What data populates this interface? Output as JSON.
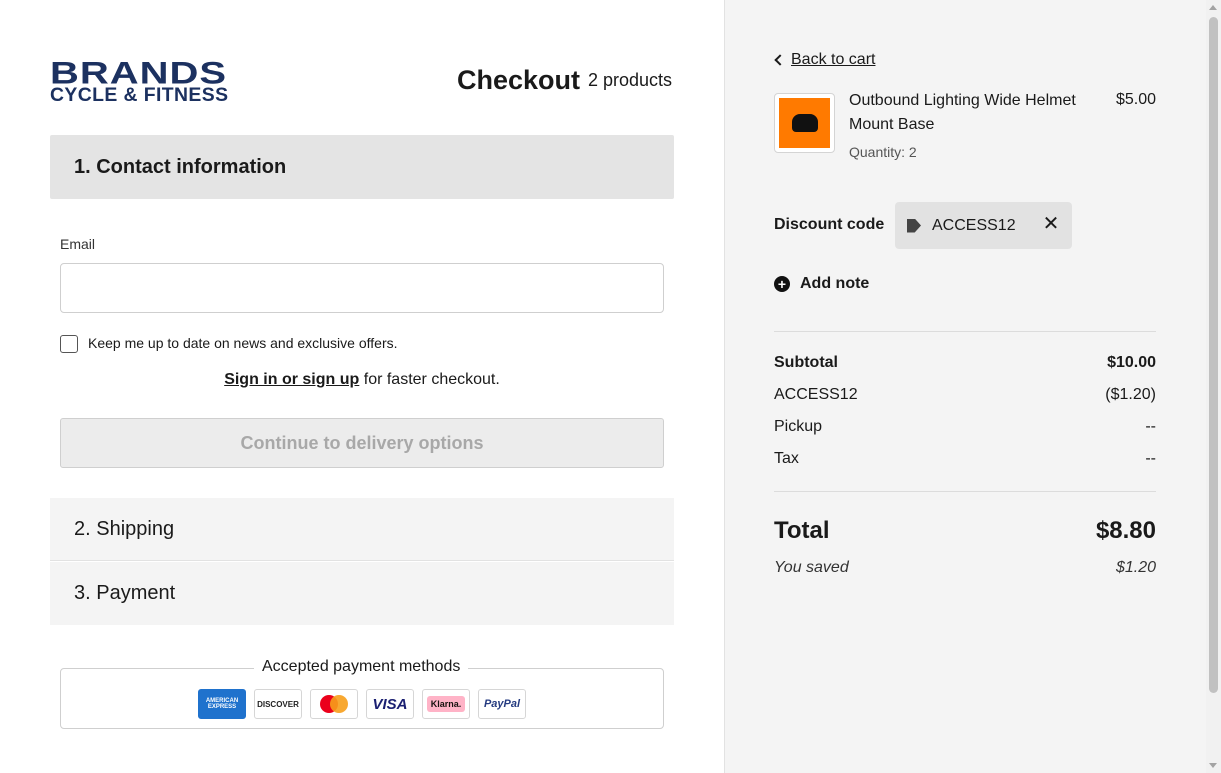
{
  "brand": {
    "logo_line1": "BRANDS",
    "logo_line2": "CYCLE & FITNESS",
    "logo_color": "#1c3160"
  },
  "header": {
    "title": "Checkout",
    "product_count": "2 products"
  },
  "steps": {
    "contact": "1. Contact information",
    "shipping": "2. Shipping",
    "payment": "3. Payment"
  },
  "contact_form": {
    "email_label": "Email",
    "email_value": "",
    "newsletter_label": "Keep me up to date on news and exclusive offers.",
    "newsletter_checked": false,
    "signin_link": "Sign in or sign up",
    "signin_suffix": " for faster checkout.",
    "continue_button": "Continue to delivery options"
  },
  "payment_methods": {
    "legend": "Accepted payment methods",
    "methods": [
      {
        "icon": "amex-icon",
        "label": "AMERICAN EXPRESS"
      },
      {
        "icon": "discover-icon",
        "label": "DISCOVER"
      },
      {
        "icon": "mastercard-icon",
        "label": "mastercard"
      },
      {
        "icon": "visa-icon",
        "label": "VISA"
      },
      {
        "icon": "klarna-icon",
        "label": "Klarna."
      },
      {
        "icon": "paypal-icon",
        "label": "PayPal"
      }
    ]
  },
  "summary": {
    "back_link": "Back to cart",
    "product": {
      "name": "Outbound Lighting Wide Helmet Mount Base",
      "quantity": "Quantity: 2",
      "price": "$5.00",
      "image_color": "#ff7a00"
    },
    "discount": {
      "label": "Discount code",
      "code": "ACCESS12"
    },
    "add_note": "Add note",
    "rows": {
      "subtotal_label": "Subtotal",
      "subtotal_value": "$10.00",
      "discount_label": "ACCESS12",
      "discount_value": "($1.20)",
      "pickup_label": "Pickup",
      "pickup_value": "--",
      "tax_label": "Tax",
      "tax_value": "--"
    },
    "total_label": "Total",
    "total_value": "$8.80",
    "saved_label": "You saved",
    "saved_value": "$1.20"
  }
}
